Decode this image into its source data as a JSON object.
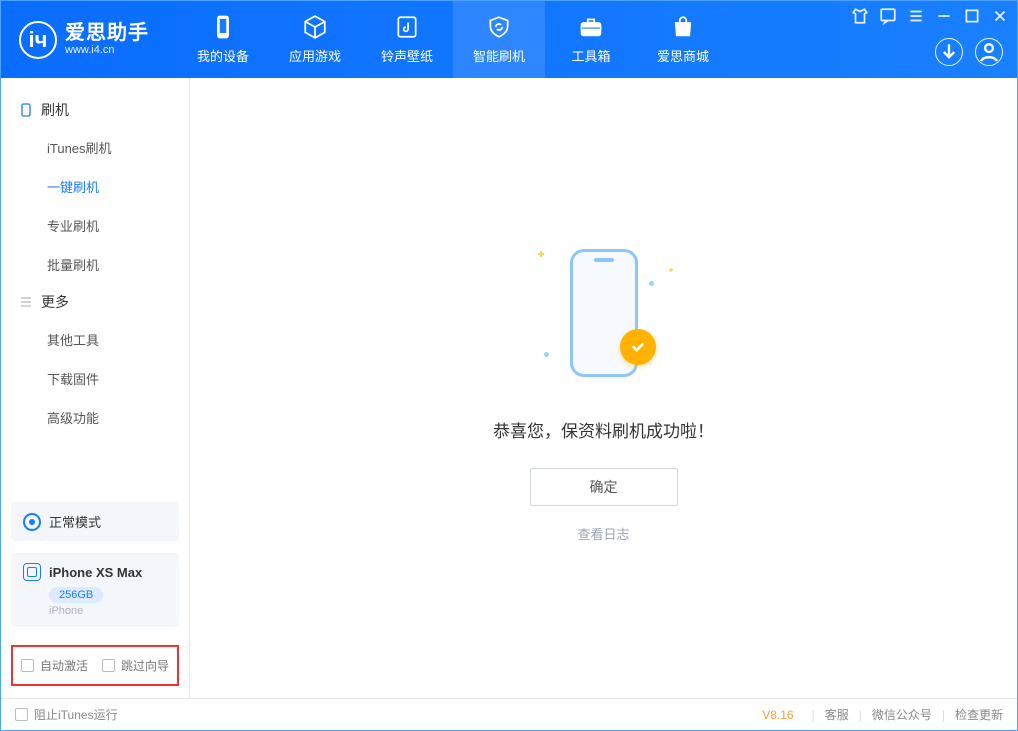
{
  "app": {
    "title": "爱思助手",
    "subtitle": "www.i4.cn"
  },
  "nav": {
    "items": [
      {
        "label": "我的设备"
      },
      {
        "label": "应用游戏"
      },
      {
        "label": "铃声壁纸"
      },
      {
        "label": "智能刷机"
      },
      {
        "label": "工具箱"
      },
      {
        "label": "爱思商城"
      }
    ]
  },
  "sidebar": {
    "group1": {
      "title": "刷机",
      "items": [
        "iTunes刷机",
        "一键刷机",
        "专业刷机",
        "批量刷机"
      ]
    },
    "group2": {
      "title": "更多",
      "items": [
        "其他工具",
        "下载固件",
        "高级功能"
      ]
    },
    "status": "正常模式",
    "device": {
      "name": "iPhone XS Max",
      "capacity": "256GB",
      "type": "iPhone"
    },
    "opts": {
      "auto_activate": "自动激活",
      "skip_guide": "跳过向导"
    }
  },
  "main": {
    "message": "恭喜您，保资料刷机成功啦！",
    "ok_label": "确定",
    "log_link": "查看日志"
  },
  "footer": {
    "block_itunes": "阻止iTunes运行",
    "version": "V8.16",
    "links": [
      "客服",
      "微信公众号",
      "检查更新"
    ]
  }
}
